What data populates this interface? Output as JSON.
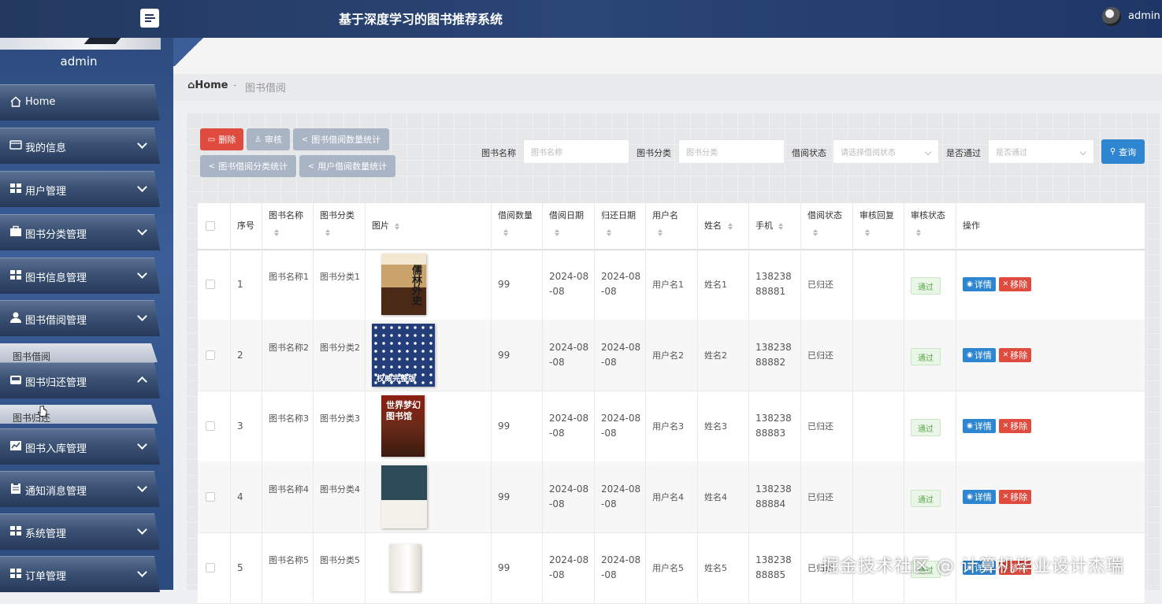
{
  "header": {
    "title": "基于深度学习的图书推荐系统",
    "username": "admin"
  },
  "sidebar": {
    "username": "admin",
    "items": [
      {
        "label": "Home",
        "icon": "home-icon"
      },
      {
        "label": "我的信息",
        "icon": "id-card-icon"
      },
      {
        "label": "用户管理",
        "icon": "grid-icon"
      },
      {
        "label": "图书分类管理",
        "icon": "briefcase-icon"
      },
      {
        "label": "图书信息管理",
        "icon": "grid-icon"
      },
      {
        "label": "图书借阅管理",
        "icon": "user-icon"
      },
      {
        "label": "图书归还管理",
        "icon": "inbox-icon"
      },
      {
        "label": "图书入库管理",
        "icon": "chart-icon"
      },
      {
        "label": "通知消息管理",
        "icon": "clipboard-icon"
      },
      {
        "label": "系统管理",
        "icon": "grid-icon"
      },
      {
        "label": "订单管理",
        "icon": "grid-icon"
      }
    ],
    "sub_borrow": "图书借阅",
    "sub_return": "图书归还"
  },
  "breadcrumb": {
    "home": "Home",
    "sep": "-",
    "current": "图书借阅"
  },
  "toolbar": {
    "delete": "删除",
    "audit": "审核",
    "stat_borrow_count": "图书借阅数量统计",
    "stat_category": "图书借阅分类统计",
    "stat_user": "用户借阅数量统计",
    "query": "查询"
  },
  "filters": {
    "book_name_label": "图书名称",
    "book_name_placeholder": "图书名称",
    "category_label": "图书分类",
    "category_placeholder": "图书分类",
    "status_label": "借阅状态",
    "status_placeholder": "请选择借阅状态",
    "pass_label": "是否通过",
    "pass_placeholder": "是否通过"
  },
  "table": {
    "headers": [
      "序号",
      "图书名称",
      "图书分类",
      "图片",
      "借阅数量",
      "借阅日期",
      "归还日期",
      "用户名",
      "姓名",
      "手机",
      "借阅状态",
      "审核回复",
      "审核状态",
      "操作"
    ],
    "detail_label": "详情",
    "remove_label": "移除",
    "rows": [
      {
        "no": "1",
        "name": "图书名称1",
        "category": "图书分类1",
        "cover_title": "儒林外史",
        "count": "99",
        "borrow_date": "2024-08-08",
        "return_date": "2024-08-08",
        "username": "用户名1",
        "real_name": "姓名1",
        "phone": "13823888881",
        "status": "已归还",
        "reply": "",
        "audit": "通过"
      },
      {
        "no": "2",
        "name": "图书名称2",
        "category": "图书分类2",
        "cover_title": "权威完整版",
        "count": "99",
        "borrow_date": "2024-08-08",
        "return_date": "2024-08-08",
        "username": "用户名2",
        "real_name": "姓名2",
        "phone": "13823888882",
        "status": "已归还",
        "reply": "",
        "audit": "通过"
      },
      {
        "no": "3",
        "name": "图书名称3",
        "category": "图书分类3",
        "cover_title": "世界梦幻图书馆",
        "count": "99",
        "borrow_date": "2024-08-08",
        "return_date": "2024-08-08",
        "username": "用户名3",
        "real_name": "姓名3",
        "phone": "13823888883",
        "status": "已归还",
        "reply": "",
        "audit": "通过"
      },
      {
        "no": "4",
        "name": "图书名称4",
        "category": "图书分类4",
        "cover_title": "",
        "count": "99",
        "borrow_date": "2024-08-08",
        "return_date": "2024-08-08",
        "username": "用户名4",
        "real_name": "姓名4",
        "phone": "13823888884",
        "status": "已归还",
        "reply": "",
        "audit": "通过"
      },
      {
        "no": "5",
        "name": "图书名称5",
        "category": "图书分类5",
        "cover_title": "",
        "count": "99",
        "borrow_date": "2024-08-08",
        "return_date": "2024-08-08",
        "username": "用户名5",
        "real_name": "姓名5",
        "phone": "13823888885",
        "status": "已归还",
        "reply": "",
        "audit": "通过"
      }
    ]
  },
  "watermark": "掘金技术社区 @ 计算机毕业设计杰瑞",
  "colors": {
    "primary": "#2f86d0",
    "danger": "#e04b3f",
    "header": "#23395f",
    "success": "#5aa84a"
  }
}
